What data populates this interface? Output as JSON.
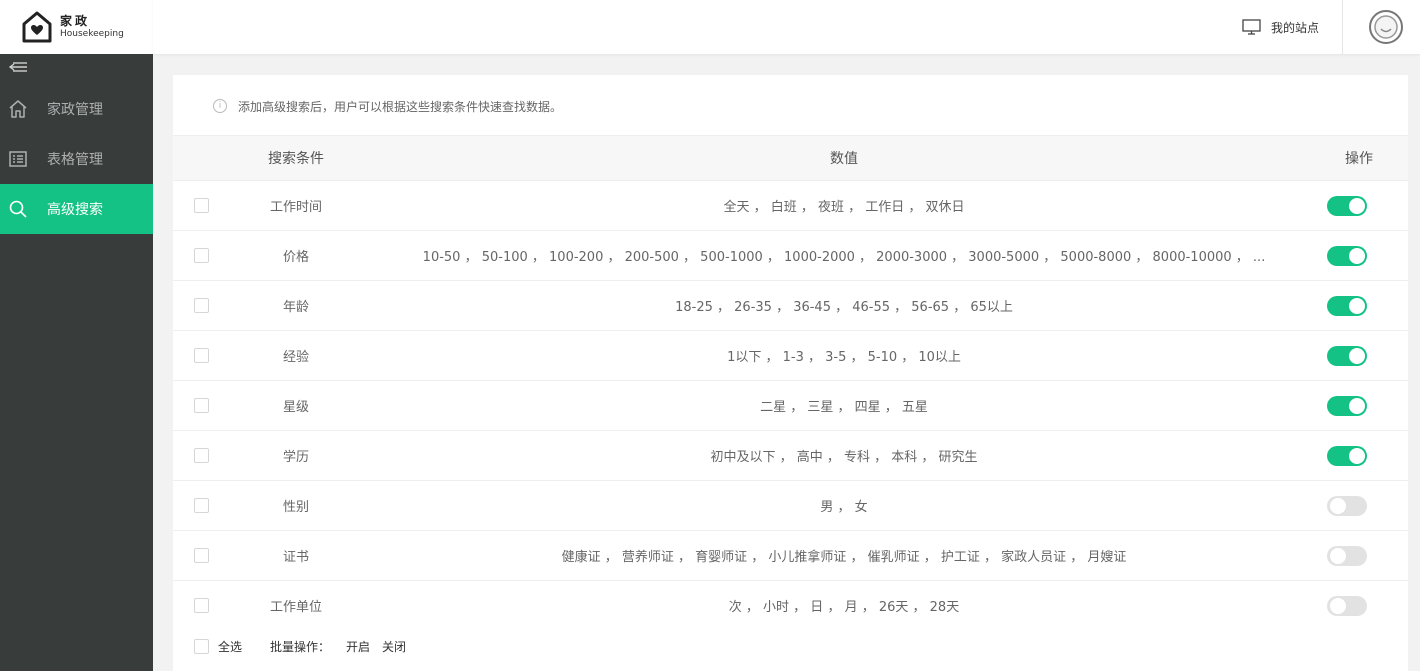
{
  "logo": {
    "cn": "家政",
    "en": "Housekeeping"
  },
  "sidebar": {
    "items": [
      {
        "label": "家政管理",
        "icon": "home-icon"
      },
      {
        "label": "表格管理",
        "icon": "list-icon"
      },
      {
        "label": "高级搜索",
        "icon": "search-icon",
        "active": true
      }
    ]
  },
  "header": {
    "my_site": "我的站点"
  },
  "tip": "添加高级搜索后，用户可以根据这些搜索条件快速查找数据。",
  "table": {
    "headers": {
      "condition": "搜索条件",
      "value": "数值",
      "operation": "操作"
    },
    "rows": [
      {
        "condition": "工作时间",
        "value": "全天 ， 白班 ， 夜班 ， 工作日 ， 双休日",
        "enabled": true
      },
      {
        "condition": "价格",
        "value": "10-50 ， 50-100 ， 100-200 ， 200-500 ， 500-1000 ， 1000-2000 ， 2000-3000 ， 3000-5000 ， 5000-8000 ， 8000-10000 ， ...",
        "enabled": true
      },
      {
        "condition": "年龄",
        "value": "18-25 ， 26-35 ， 36-45 ， 46-55 ， 56-65 ， 65以上",
        "enabled": true
      },
      {
        "condition": "经验",
        "value": "1以下 ， 1-3 ， 3-5 ， 5-10 ， 10以上",
        "enabled": true
      },
      {
        "condition": "星级",
        "value": "二星 ， 三星 ， 四星 ， 五星",
        "enabled": true
      },
      {
        "condition": "学历",
        "value": "初中及以下 ， 高中 ， 专科 ， 本科 ， 研究生",
        "enabled": true
      },
      {
        "condition": "性别",
        "value": "男 ， 女",
        "enabled": false
      },
      {
        "condition": "证书",
        "value": "健康证 ， 营养师证 ， 育婴师证 ， 小儿推拿师证 ， 催乳师证 ， 护工证 ， 家政人员证 ， 月嫂证",
        "enabled": false
      },
      {
        "condition": "工作单位",
        "value": "次 ， 小时 ， 日 ， 月 ， 26天 ， 28天",
        "enabled": false
      }
    ]
  },
  "footer": {
    "select_all": "全选",
    "batch_label": "批量操作：",
    "enable": "开启",
    "disable": "关闭"
  },
  "colors": {
    "accent": "#14c286",
    "sidebar_bg": "#383c3b"
  }
}
